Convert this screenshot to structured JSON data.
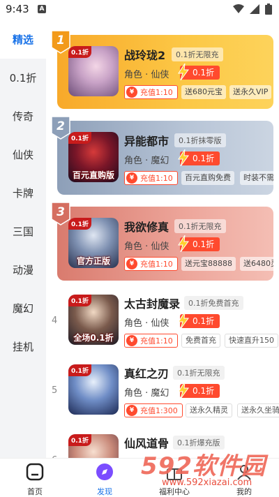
{
  "status": {
    "time": "9:43",
    "notif": "A"
  },
  "sidebar": {
    "items": [
      {
        "label": "精选"
      },
      {
        "label": "0.1折"
      },
      {
        "label": "传奇"
      },
      {
        "label": "仙侠"
      },
      {
        "label": "卡牌"
      },
      {
        "label": "三国"
      },
      {
        "label": "动漫"
      },
      {
        "label": "魔幻"
      },
      {
        "label": "挂机"
      }
    ],
    "active_index": 0
  },
  "games": [
    {
      "rank": "1",
      "title": "战玲珑2",
      "promo": "0.1折无限充",
      "genre": "角色 · 仙侠",
      "discount": "0.1折",
      "charge": "充值1:10",
      "benefits": [
        "送680元宝",
        "送永久VIP"
      ],
      "icon_tag": "0.1折",
      "icon_caption": ""
    },
    {
      "rank": "2",
      "title": "异能都市",
      "promo": "0.1折抹零版",
      "genre": "角色 · 魔幻",
      "discount": "0.1折",
      "charge": "充值1:10",
      "benefits": [
        "百元直购免费",
        "时装不需"
      ],
      "icon_tag": "0.1折",
      "icon_caption": "百元直购版"
    },
    {
      "rank": "3",
      "title": "我欲修真",
      "promo": "0.1折无限充",
      "genre": "角色 · 仙侠",
      "discount": "0.1折",
      "charge": "充值1:10",
      "benefits": [
        "送元宝88888",
        "送6480灵"
      ],
      "icon_tag": "0.1折",
      "icon_caption": "官方正版"
    },
    {
      "rank": "4",
      "title": "太古封魔录",
      "promo": "0.1折免费首充",
      "genre": "角色 · 仙侠",
      "discount": "0.1折",
      "charge": "充值1:10",
      "benefits": [
        "免费首充",
        "快速直升150"
      ],
      "icon_tag": "0.1折",
      "icon_caption": "全场0.1折"
    },
    {
      "rank": "5",
      "title": "真红之刃",
      "promo": "0.1折无限充",
      "genre": "角色 · 魔幻",
      "discount": "0.1折",
      "charge": "充值1:300",
      "benefits": [
        "送永久精灵",
        "送永久坐骑"
      ],
      "icon_tag": "0.1折",
      "icon_caption": ""
    },
    {
      "rank": "6",
      "title": "仙风道骨",
      "promo": "0.1折爆充版",
      "genre": "",
      "discount": "",
      "charge": "",
      "benefits": [],
      "icon_tag": "0.1折",
      "icon_caption": ""
    }
  ],
  "bottom_nav": [
    {
      "label": "首页"
    },
    {
      "label": "发现"
    },
    {
      "label": "福利中心"
    },
    {
      "label": "我的"
    }
  ],
  "watermark": {
    "big": "592软件园",
    "small": "www.592xiazai.com"
  },
  "colors": {
    "accent": "#1a73e8",
    "discount": "#ff4a2e",
    "gold": "#fcc846",
    "silver": "#b7c4d6",
    "bronze": "#eda69b"
  }
}
